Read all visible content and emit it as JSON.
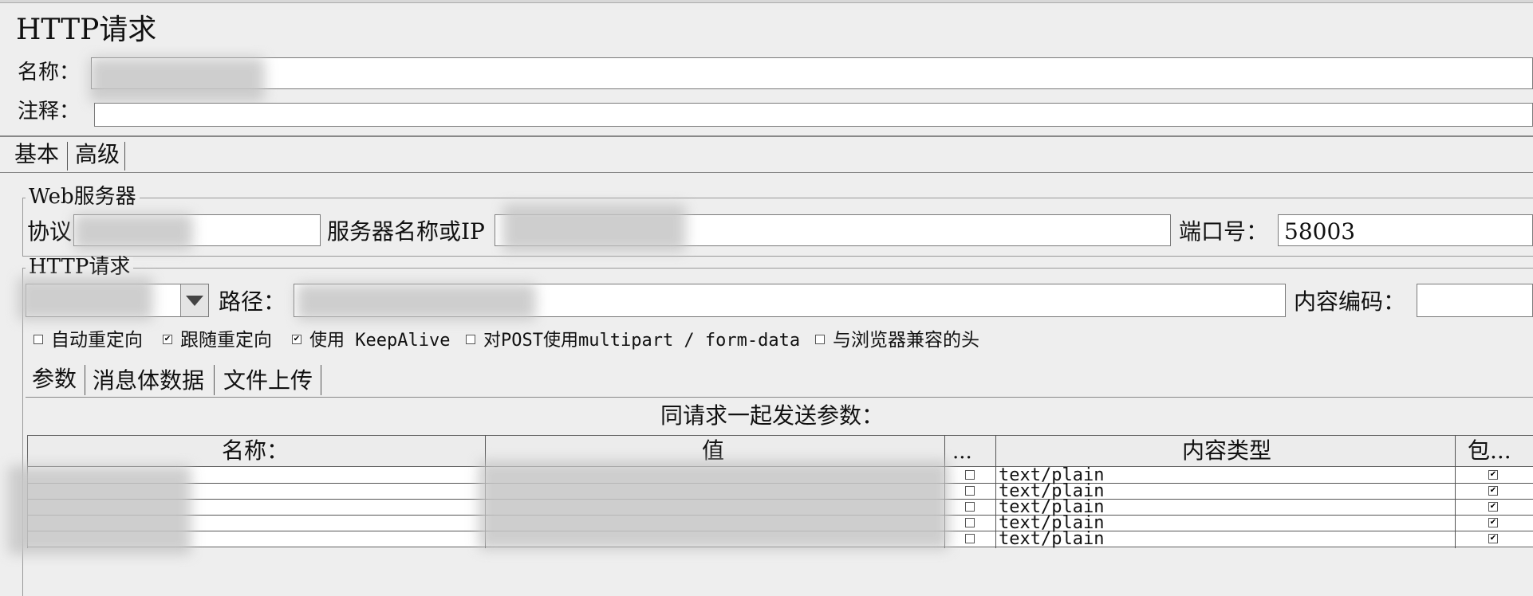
{
  "title": "HTTP请求",
  "name_label": "名称：",
  "comment_label": "注释：",
  "top_tabs": [
    {
      "label": "基本"
    },
    {
      "label": "高级"
    }
  ],
  "web_server": {
    "legend": "Web服务器",
    "protocol_label": "协议",
    "server_label": "服务器名称或IP",
    "port_label": "端口号：",
    "port_value": "58003"
  },
  "http_request": {
    "legend": "HTTP请求",
    "path_label": "路径：",
    "encoding_label": "内容编码："
  },
  "options": [
    {
      "label": "自动重定向",
      "checked": false
    },
    {
      "label": "跟随重定向",
      "checked": true
    },
    {
      "label": "使用 KeepAlive",
      "checked": true
    },
    {
      "label": "对POST使用multipart / form-data",
      "checked": false
    },
    {
      "label": "与浏览器兼容的头",
      "checked": false
    }
  ],
  "sub_tabs": [
    {
      "label": "参数"
    },
    {
      "label": "消息体数据"
    },
    {
      "label": "文件上传"
    }
  ],
  "params_title": "同请求一起发送参数：",
  "table": {
    "columns": [
      "名称：",
      "值",
      "...",
      "内容类型",
      "包..."
    ],
    "rows": [
      {
        "encode": false,
        "content_type": "text/plain",
        "include": true
      },
      {
        "encode": false,
        "content_type": "text/plain",
        "include": true
      },
      {
        "encode": false,
        "content_type": "text/plain",
        "include": true
      },
      {
        "encode": false,
        "content_type": "text/plain",
        "include": true
      },
      {
        "encode": false,
        "content_type": "text/plain",
        "include": true
      }
    ]
  },
  "check_glyph": "✔"
}
